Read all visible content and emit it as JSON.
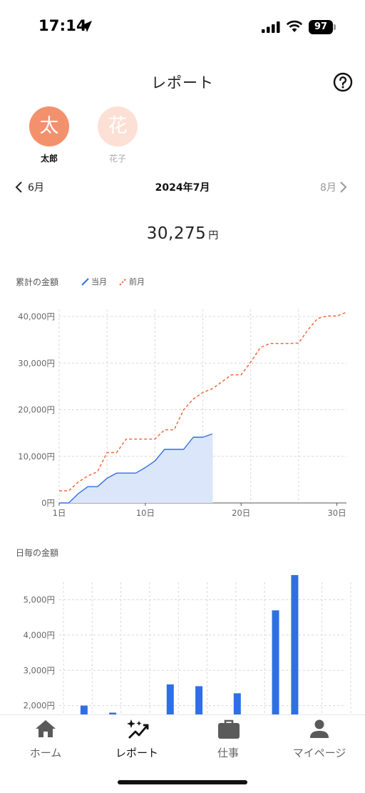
{
  "status_bar": {
    "time": "17:14",
    "battery": "97"
  },
  "header": {
    "title": "レポート"
  },
  "users": [
    {
      "initial": "太",
      "name": "太郎",
      "color": "#f4916d",
      "active": true
    },
    {
      "initial": "花",
      "name": "花子",
      "color": "#fde0d5",
      "active": false
    }
  ],
  "month_nav": {
    "prev": "6月",
    "current": "2024年7月",
    "next": "8月"
  },
  "total": {
    "amount": "30,275",
    "unit": "円"
  },
  "cumulative_section": {
    "title": "累計の金額",
    "legend_current": "当月",
    "legend_previous": "前月"
  },
  "daily_section": {
    "title": "日毎の金額"
  },
  "colors": {
    "current": "#2f6fe4",
    "current_fill": "#dbe6fb",
    "previous": "#ef6b3b",
    "grid": "#d8d8d8"
  },
  "chart_data": [
    {
      "type": "line",
      "title": "累計の金額",
      "x_ticks": [
        1,
        10,
        20,
        30
      ],
      "x_tick_labels": [
        "1日",
        "10日",
        "20日",
        "30日"
      ],
      "y_ticks": [
        0,
        10000,
        20000,
        30000,
        40000
      ],
      "y_tick_labels": [
        "0円",
        "10,000円",
        "20,000円",
        "30,000円",
        "40,000円"
      ],
      "xlim": [
        1,
        31
      ],
      "ylim": [
        0,
        40000
      ],
      "grid": true,
      "series": [
        {
          "name": "当月",
          "style": "solid",
          "area": true,
          "x": [
            1,
            2,
            3,
            4,
            5,
            6,
            7,
            8,
            9,
            10,
            11,
            12,
            13,
            14,
            15,
            16,
            17
          ],
          "y": [
            0,
            0,
            2000,
            3500,
            3500,
            5300,
            6400,
            6400,
            6400,
            7600,
            9000,
            11500,
            11500,
            11500,
            14100,
            14100,
            14800
          ]
        },
        {
          "name": "前月",
          "style": "dashed",
          "area": false,
          "x": [
            1,
            2,
            3,
            4,
            5,
            6,
            7,
            8,
            9,
            10,
            11,
            12,
            13,
            14,
            15,
            16,
            17,
            18,
            19,
            20,
            21,
            22,
            23,
            24,
            25,
            26,
            27,
            28,
            29,
            30,
            31
          ],
          "y": [
            2600,
            2600,
            4500,
            5800,
            6700,
            10800,
            10800,
            13700,
            13700,
            13700,
            13700,
            15700,
            15700,
            20000,
            22300,
            23700,
            24500,
            26000,
            27500,
            27500,
            30200,
            33300,
            34200,
            34200,
            34200,
            34300,
            37200,
            39600,
            40100,
            40100,
            40900
          ]
        }
      ]
    },
    {
      "type": "bar",
      "title": "日毎の金額",
      "y_ticks": [
        2000,
        3000,
        4000,
        5000
      ],
      "y_tick_labels": [
        "2,000円",
        "3,000円",
        "4,000円",
        "5,000円"
      ],
      "ylim": [
        1750,
        5800
      ],
      "xlim": [
        1,
        31
      ],
      "grid": true,
      "x": [
        3,
        6,
        12,
        15,
        19,
        23,
        25
      ],
      "values": [
        2000,
        1800,
        2600,
        2550,
        2350,
        4700,
        5700
      ]
    }
  ],
  "tabbar": {
    "tabs": [
      {
        "label": "ホーム",
        "icon": "home-icon"
      },
      {
        "label": "レポート",
        "icon": "sparkle-chart-icon"
      },
      {
        "label": "仕事",
        "icon": "briefcase-icon"
      },
      {
        "label": "マイページ",
        "icon": "person-icon"
      }
    ]
  }
}
